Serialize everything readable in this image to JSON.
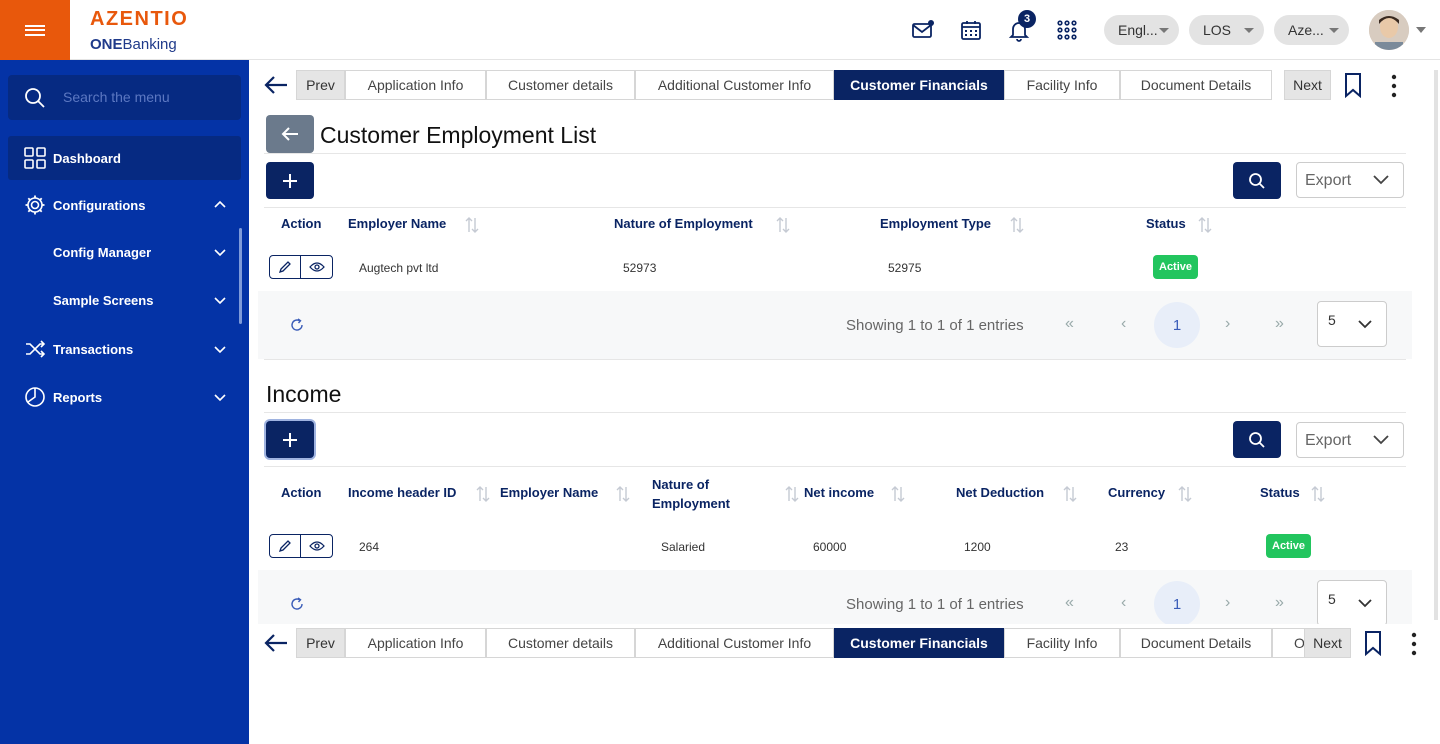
{
  "brand": {
    "logo_top": "AZENTIO",
    "logo_bottom_bold": "ONE",
    "logo_bottom_rest": "Banking"
  },
  "header": {
    "notifications_count": "3",
    "language": "Engl...",
    "module": "LOS",
    "entity": "Aze...",
    "icons": [
      "mail-icon",
      "calendar-icon",
      "bell-icon",
      "apps-grid-icon"
    ]
  },
  "sidebar": {
    "search_placeholder": "Search the menu",
    "items": [
      {
        "label": "Dashboard",
        "icon": "dashboard-icon"
      },
      {
        "label": "Configurations",
        "icon": "gear-icon"
      },
      {
        "label": "Config Manager"
      },
      {
        "label": "Sample Screens"
      },
      {
        "label": "Transactions",
        "icon": "shuffle-icon"
      },
      {
        "label": "Reports",
        "icon": "pie-chart-icon"
      }
    ]
  },
  "tabs": {
    "prev": "Prev",
    "next": "Next",
    "items": [
      "Application Info",
      "Customer details",
      "Additional Customer Info",
      "Customer Financials",
      "Facility Info",
      "Document Details"
    ],
    "overflow_item": "O",
    "active": "Customer Financials"
  },
  "employment": {
    "title": "Customer Employment List",
    "export_label": "Export",
    "columns": [
      "Action",
      "Employer Name",
      "Nature of Employment",
      "Employment Type",
      "Status"
    ],
    "rows": [
      {
        "employer_name": "Augtech pvt ltd",
        "nature": "52973",
        "type": "52975",
        "status": "Active"
      }
    ],
    "footer": {
      "showing": "Showing 1 to 1 of 1 entries",
      "page": "1",
      "per_page": "5"
    }
  },
  "income": {
    "title": "Income",
    "export_label": "Export",
    "columns": [
      "Action",
      "Income header ID",
      "Employer Name",
      "Nature of Employment",
      "Net income",
      "Net Deduction",
      "Currency",
      "Status"
    ],
    "rows": [
      {
        "id": "264",
        "employer_name": "",
        "nature": "Salaried",
        "net_income": "60000",
        "net_deduction": "1200",
        "currency": "23",
        "status": "Active"
      }
    ],
    "footer": {
      "showing": "Showing 1 to 1 of 1 entries",
      "page": "1",
      "per_page": "5"
    }
  },
  "pager_symbols": {
    "first": "«",
    "prev": "‹",
    "next": "›",
    "last": "»"
  },
  "colors": {
    "navy": "#0a2463",
    "sidebar": "#0433a6",
    "orange": "#e8580c",
    "active_green": "#22c55e"
  }
}
